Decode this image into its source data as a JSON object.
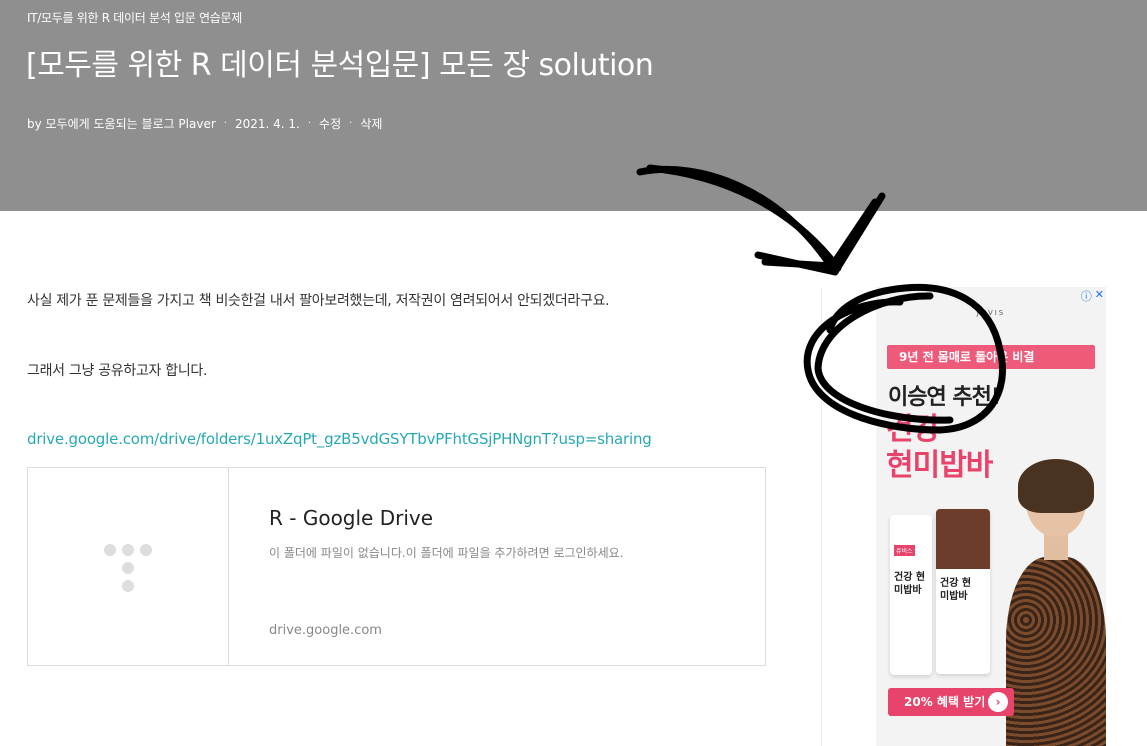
{
  "header": {
    "category": "IT/모두를 위한 R 데이터 분석 입문 연습문제",
    "title": "[모두를 위한 R 데이터 분석입문] 모든 장 solution",
    "meta": {
      "author": "by 모두에게 도움되는 블로그 Plaver",
      "date": "2021. 4. 1.",
      "edit_label": "수정",
      "delete_label": "삭제",
      "separator": "·"
    }
  },
  "content": {
    "paragraph1": "사실 제가 푼 문제들을 가지고 책 비슷한걸 내서 팔아보려했는데, 저작권이 염려되어서 안되겠더라구요.",
    "paragraph2": "그래서 그냥 공유하고자 합니다.",
    "link_text": "drive.google.com/drive/folders/1uxZqPt_gzB5vdGSYTbvPFhtGSjPHNgnT?usp=sharing",
    "card": {
      "title": "R - Google Drive",
      "description": "이 폴더에 파일이 없습니다.이 폴더에 파일을 추가하려면 로그인하세요.",
      "host": "drive.google.com"
    }
  },
  "ad": {
    "info_icon": "ⓘ",
    "close_icon": "✕",
    "brand": "JUVIS",
    "pill": "9년 전 몸매로 돌아온 비결",
    "headline": "이승연 추천!",
    "product_line1": "건강",
    "product_line2": "현미밥바",
    "bag_label": "건강 현미밥바",
    "bag_tag": "쥬비스",
    "cta": "20% 혜택 받기",
    "cta_arrow": "›",
    "accent_color": "#e8436a"
  },
  "colors": {
    "header_bg": "#8f8f8f",
    "link": "#26a9b5"
  }
}
